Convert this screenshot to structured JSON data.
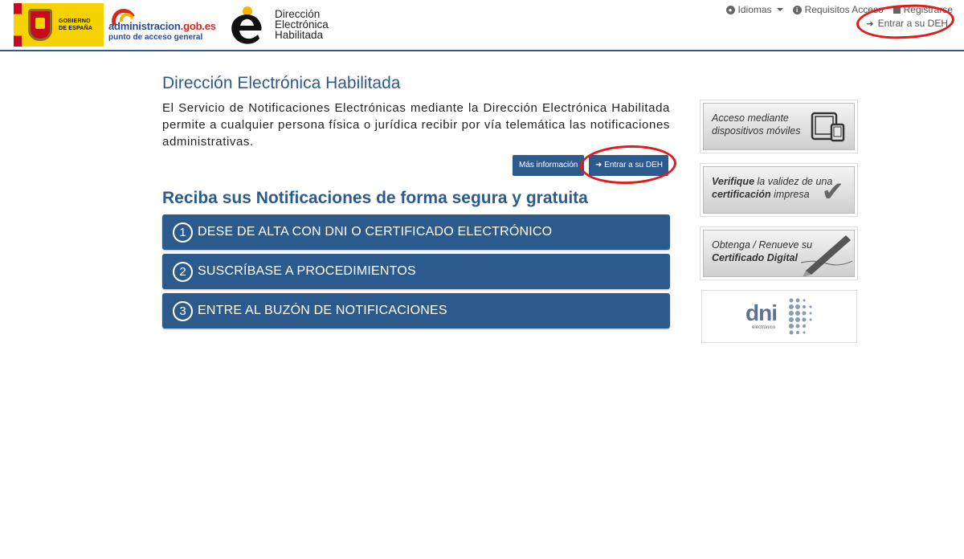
{
  "header": {
    "gov_logo_text": [
      "GOBIERNO",
      "DE ESPAÑA"
    ],
    "admin_logo": {
      "name": "administracion",
      "domain": ".gob.es",
      "subtitle": "punto de acceso general"
    },
    "deh_logo_lines": [
      "Dirección",
      "Electrónica",
      "Habilitada"
    ],
    "nav": {
      "languages": "Idiomas",
      "requirements": "Requisitos Acceso",
      "register": "Registrarse",
      "login": "Entrar a su DEH"
    }
  },
  "main": {
    "title": "Dirección Electrónica Habilitada",
    "intro": "El Servicio de Notificaciones Electrónicas mediante la Dirección Electrónica Habilitada permite a cualquier persona física o jurídica recibir por vía telemática las notificaciones administrativas.",
    "more_info_button": "Más información",
    "enter_button": "Entrar a su DEH",
    "subtitle": "Reciba sus Notificaciones de forma segura y gratuita",
    "steps": [
      {
        "number": "1",
        "label": "DESE DE ALTA CON DNI O CERTIFICADO ELECTRÓNICO"
      },
      {
        "number": "2",
        "label": "SUSCRÍBASE A PROCEDIMIENTOS"
      },
      {
        "number": "3",
        "label": "ENTRE AL BUZÓN DE NOTIFICACIONES"
      }
    ]
  },
  "sidebar": {
    "mobile": {
      "line1": "Acceso mediante",
      "line2": "dispositivos móviles",
      "icon": "devices-icon"
    },
    "verify": {
      "strong1": "Verifique",
      "text1": " la validez de una",
      "strong2": "certificación",
      "text2": " impresa",
      "icon": "checkmark-icon"
    },
    "certificate": {
      "line1": "Obtenga / Renueve su",
      "line2": "Certificado Digital",
      "icon": "pen-icon"
    },
    "dni": {
      "word": "dni",
      "sub": "electrónico"
    }
  },
  "colors": {
    "brand": "#2d5a8c",
    "annotation": "#e11a1a"
  }
}
